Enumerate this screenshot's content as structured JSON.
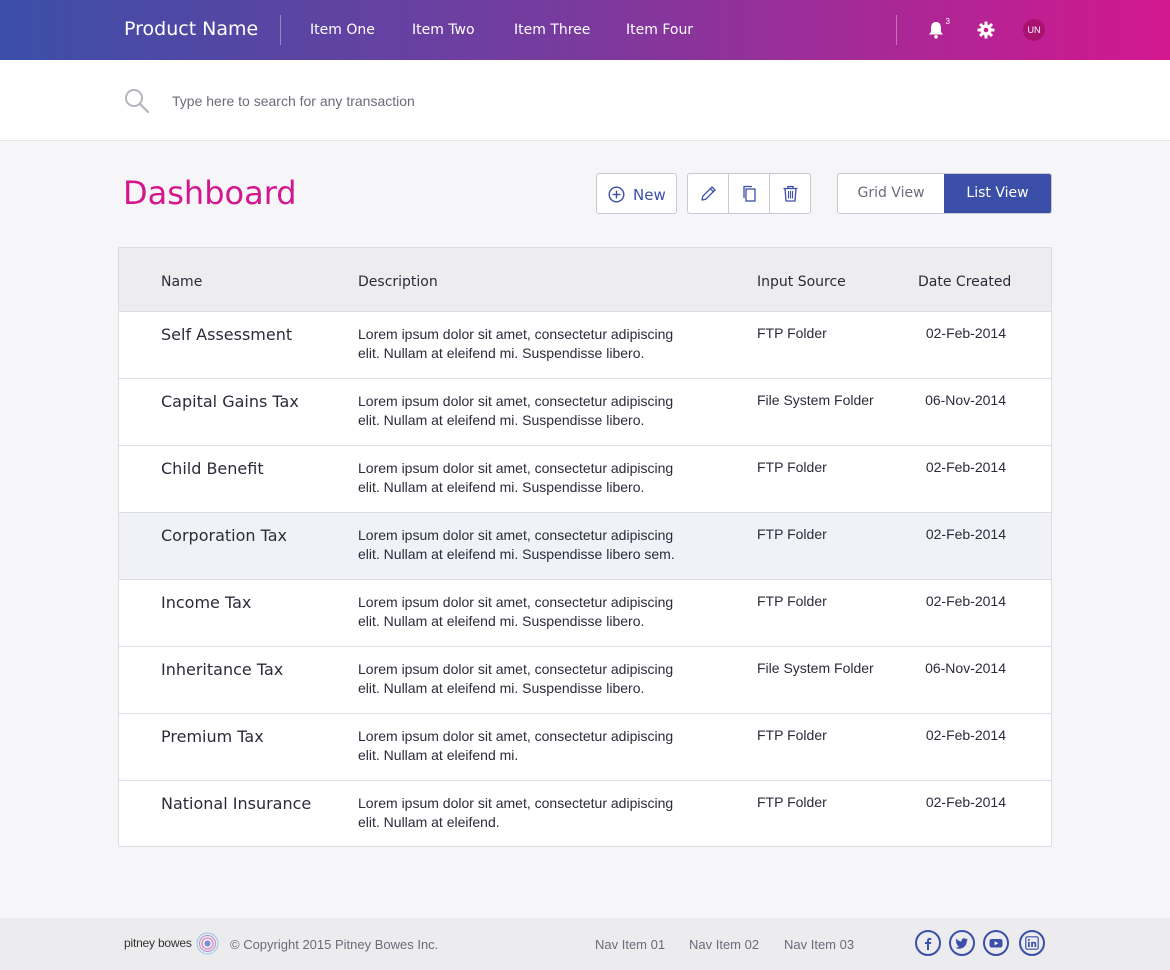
{
  "header": {
    "product_name": "Product Name",
    "nav": [
      "Item One",
      "Item Two",
      "Item Three",
      "Item Four"
    ],
    "notification_count": "3",
    "avatar_initials": "UN",
    "icons": [
      "bell-icon",
      "gear-icon"
    ]
  },
  "search": {
    "placeholder": "Type here to search for any transaction",
    "value": ""
  },
  "page": {
    "title": "Dashboard"
  },
  "toolbar": {
    "new_label": "New",
    "actions": [
      "edit-icon",
      "copy-icon",
      "trash-icon"
    ],
    "grid_view_label": "Grid View",
    "list_view_label": "List View",
    "active_view": "List View"
  },
  "table": {
    "columns": [
      "Name",
      "Description",
      "Input Source",
      "Date Created"
    ],
    "rows": [
      {
        "name": "Self Assessment",
        "description": "Lorem ipsum dolor sit amet, consectetur adipiscing elit. Nullam at eleifend mi. Suspendisse libero.",
        "source": "FTP Folder",
        "date": "02-Feb-2014"
      },
      {
        "name": "Capital Gains Tax",
        "description": "Lorem ipsum dolor sit amet, consectetur adipiscing elit. Nullam at eleifend mi. Suspendisse libero.",
        "source": "File System Folder",
        "date": "06-Nov-2014"
      },
      {
        "name": "Child Benefit",
        "description": "Lorem ipsum dolor sit amet, consectetur adipiscing elit. Nullam at eleifend mi. Suspendisse libero.",
        "source": "FTP Folder",
        "date": "02-Feb-2014"
      },
      {
        "name": "Corporation Tax",
        "description": "Lorem ipsum dolor sit amet, consectetur adipiscing elit. Nullam at eleifend mi. Suspendisse libero sem.",
        "source": "FTP Folder",
        "date": "02-Feb-2014"
      },
      {
        "name": "Income Tax",
        "description": "Lorem ipsum dolor sit amet, consectetur adipiscing elit. Nullam at eleifend mi. Suspendisse libero.",
        "source": "FTP Folder",
        "date": "02-Feb-2014"
      },
      {
        "name": "Inheritance Tax",
        "description": "Lorem ipsum dolor sit amet, consectetur adipiscing elit. Nullam at eleifend mi. Suspendisse libero.",
        "source": "File System Folder",
        "date": "06-Nov-2014"
      },
      {
        "name": "Premium Tax",
        "description": "Lorem ipsum dolor sit amet, consectetur adipiscing elit. Nullam at eleifend mi.",
        "source": "FTP Folder",
        "date": "02-Feb-2014"
      },
      {
        "name": "National Insurance",
        "description": "Lorem ipsum dolor sit amet, consectetur adipiscing elit. Nullam at eleifend.",
        "source": "FTP Folder",
        "date": "02-Feb-2014"
      }
    ],
    "selected_row": "Corporation Tax"
  },
  "footer": {
    "logo_text": "pitney bowes",
    "copyright": "© Copyright 2015 Pitney Bowes Inc.",
    "nav": [
      "Nav Item 01",
      "Nav Item 02",
      "Nav Item 03"
    ],
    "social": [
      "facebook-icon",
      "twitter-icon",
      "youtube-icon",
      "linkedin-icon"
    ]
  },
  "colors": {
    "brand_blue": "#3b4fa8",
    "brand_magenta": "#d4178f",
    "selected_row_bg": "#f1f2f8"
  }
}
